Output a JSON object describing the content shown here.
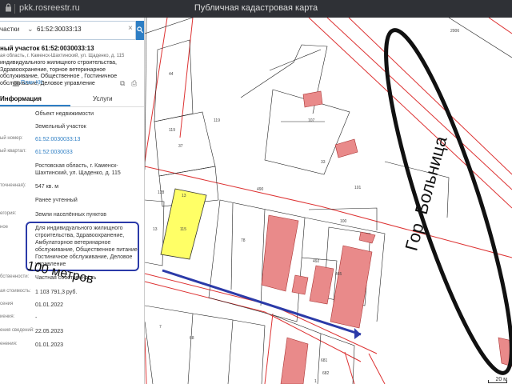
{
  "browser": {
    "url": "pkk.rosreestr.ru",
    "title": "Публичная кадастровая карта"
  },
  "search": {
    "category": "частки",
    "query": "61:52:30033:13"
  },
  "object": {
    "title": "ный участок 61:52:0030033:13",
    "address_short": "ая область, г. Каменск-Шахтинский, ул. Щаденко, д. 115",
    "use": "индивидуального жилищного строительства, Здравоохранение, торное ветеринарное обслуживание, Общественное , Гостиничное обслуживание, Деловое управление",
    "plan_link": "План КК"
  },
  "tabs": {
    "info": "Информация",
    "services": "Услуги"
  },
  "fields": [
    {
      "key": "",
      "value": "Объект недвижимости"
    },
    {
      "key": "",
      "value": "Земельный участок"
    },
    {
      "key": "ый номер:",
      "value": "61:52:0030033:13",
      "link": true
    },
    {
      "key": "ый квартал:",
      "value": "61:52:0030033",
      "link": true
    },
    {
      "key": "",
      "value": "Ростовская область, г. Каменск-Шахтинский, ул. Щаденко, д. 115"
    },
    {
      "key": "точненная):",
      "value": "547 кв. м"
    },
    {
      "key": "",
      "value": "Ранее учтенный"
    },
    {
      "key": "егория:",
      "value": "Земли населённых пунктов"
    },
    {
      "key": "ное",
      "value": "Для индивидуального жилищного строительства, Здравоохранение, Амбулаторное ветеринарное обслуживание, Общественное питание, Гостиничное обслуживание, Деловое управление"
    },
    {
      "key": "бственности:",
      "value": "Частная собственность"
    },
    {
      "key": "ая стоимость:",
      "value": "1 103 791,3 руб."
    },
    {
      "key": "сения",
      "value": "01.01.2022"
    },
    {
      "key": "иения:",
      "value": "-"
    },
    {
      "key": "ения сведений:",
      "value": "22.05.2023"
    },
    {
      "key": "енения:",
      "value": "01.01.2023"
    }
  ],
  "map": {
    "annotation_distance": "100 метров",
    "annotation_hospital": "Гор. Больница",
    "scale": "20 м",
    "parcel_labels": [
      "44",
      "119",
      "37",
      "13",
      "115",
      "119",
      "128",
      "13",
      "490",
      "78",
      "492",
      "100",
      "107",
      "33",
      "101",
      "465",
      "7",
      "68",
      "681",
      "682",
      "1",
      "2006"
    ]
  },
  "colors": {
    "selected_parcel": "#ffff66",
    "building": "#e98a8a",
    "annotation": "#2b3aa8",
    "red_line": "#d33"
  }
}
